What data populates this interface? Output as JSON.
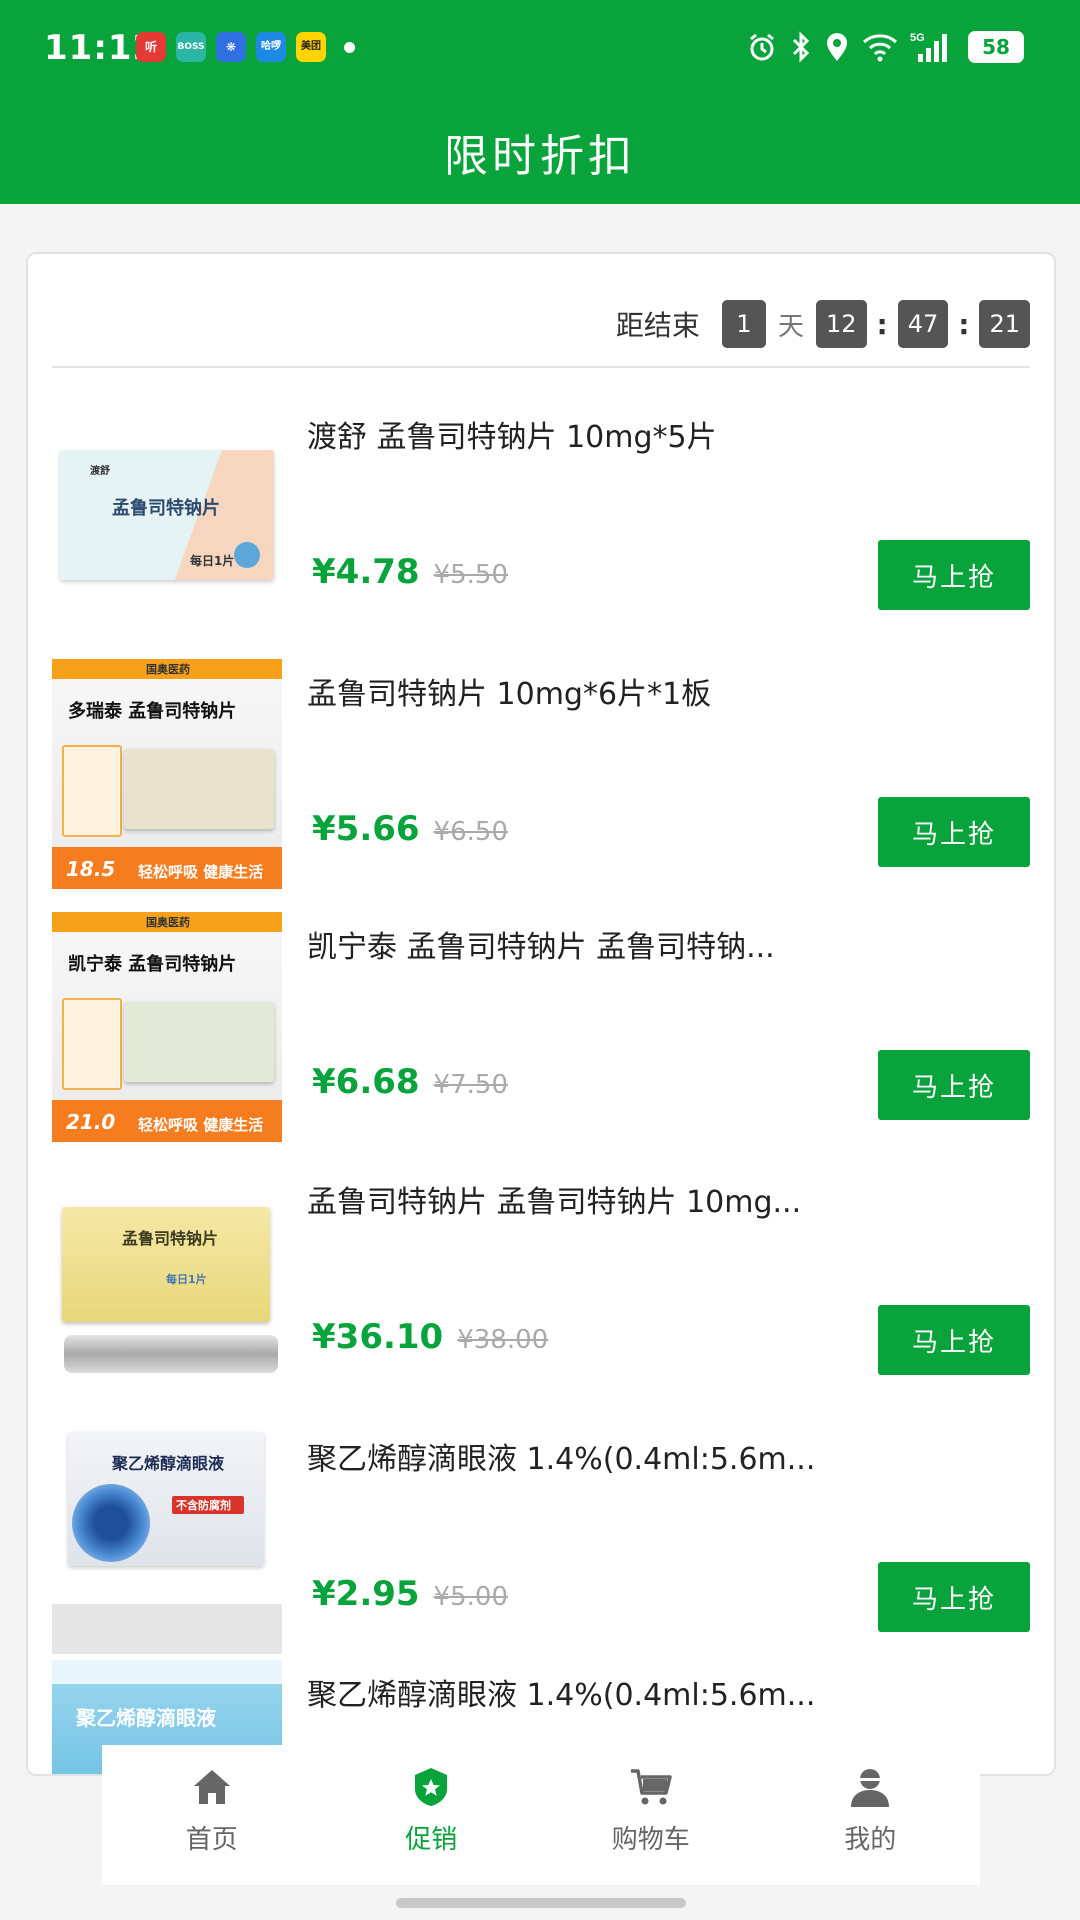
{
  "status_bar": {
    "time": "11:12",
    "app_icons": [
      {
        "icon": "ting-app-icon",
        "label": "听",
        "color": "#e53935"
      },
      {
        "icon": "boss-zhipin-app-icon",
        "label": "BOSS",
        "color": "#2bb5a4"
      },
      {
        "icon": "blue-app-icon",
        "label": "❋",
        "color": "#2f6fe0"
      },
      {
        "icon": "haluo-app-icon",
        "label": "哈啰",
        "color": "#1e88e5"
      },
      {
        "icon": "meituan-app-icon",
        "label": "美团",
        "color": "#ffd400"
      }
    ],
    "battery": "58",
    "network": "5G"
  },
  "header": {
    "title": "限时折扣"
  },
  "countdown": {
    "label": "距结束",
    "days": "1",
    "day_unit": "天",
    "hours": "12",
    "minutes": "47",
    "seconds": "21",
    "separator": ":"
  },
  "products": [
    {
      "name": "渡舒 孟鲁司特钠片 10mg*5片",
      "price": "¥4.78",
      "original_price": "¥5.50",
      "button": "马上抢",
      "thumb": {
        "brand": "渡舒",
        "title": "孟鲁司特钠片",
        "badge": "每日1片"
      }
    },
    {
      "name": "孟鲁司特钠片 10mg*6片*1板",
      "price": "¥5.66",
      "original_price": "¥6.50",
      "button": "马上抢",
      "thumb": {
        "brand": "国奥医药",
        "title": "多瑞泰 孟鲁司特钠片",
        "price": "18.5",
        "slogan": "轻松呼吸 健康生活"
      }
    },
    {
      "name": "凯宁泰 孟鲁司特钠片 孟鲁司特钠...",
      "price": "¥6.68",
      "original_price": "¥7.50",
      "button": "马上抢",
      "thumb": {
        "brand": "国奥医药",
        "title": "凯宁泰 孟鲁司特钠片",
        "price": "21.0",
        "slogan": "轻松呼吸 健康生活"
      }
    },
    {
      "name": "孟鲁司特钠片 孟鲁司特钠片 10mg...",
      "price": "¥36.10",
      "original_price": "¥38.00",
      "button": "马上抢",
      "thumb": {
        "title": "孟鲁司特钠片",
        "badge": "每日1片"
      }
    },
    {
      "name": "聚乙烯醇滴眼液 1.4%(0.4ml:5.6m...",
      "price": "¥2.95",
      "original_price": "¥5.00",
      "button": "马上抢",
      "thumb": {
        "title": "聚乙烯醇滴眼液",
        "tag": "不含防腐剂"
      }
    },
    {
      "name": "聚乙烯醇滴眼液 1.4%(0.4ml:5.6m...",
      "price": "",
      "original_price": "",
      "button": "",
      "thumb": {
        "title": "聚乙烯醇滴眼液"
      }
    }
  ],
  "tabbar": {
    "items": [
      {
        "label": "首页",
        "icon": "home-icon",
        "active": false
      },
      {
        "label": "促销",
        "icon": "promotion-icon",
        "active": true
      },
      {
        "label": "购物车",
        "icon": "cart-icon",
        "active": false
      },
      {
        "label": "我的",
        "icon": "user-icon",
        "active": false
      }
    ]
  },
  "colors": {
    "brand": "#08a33b",
    "old_price": "#aaaaaa"
  }
}
